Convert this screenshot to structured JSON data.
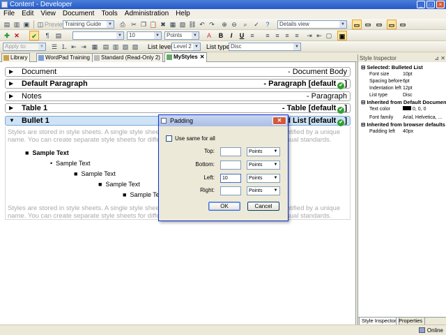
{
  "window": {
    "title": "Content - Developer"
  },
  "menu": [
    "File",
    "Edit",
    "View",
    "Document",
    "Tools",
    "Administration",
    "Help"
  ],
  "toolbar1": {
    "preview_label": "Preview",
    "template_combo": "Training Guide",
    "view_combo": "Details view"
  },
  "toolbar2": {
    "font_size_value": "10",
    "unit_value": "Points",
    "bold": "B",
    "italic": "I",
    "underline": "U"
  },
  "toolbar3": {
    "apply_to_label": "Apply to:",
    "list_level_label": "List level:",
    "list_level_value": "Level 2",
    "list_type_label": "List type:",
    "list_type_value": "Disc"
  },
  "tabs": [
    {
      "label": "Library"
    },
    {
      "label": "WordPad Training"
    },
    {
      "label": "Standard (Read-Only 2)"
    },
    {
      "label": "MyStyles"
    }
  ],
  "styles": [
    {
      "name": "Document",
      "right": "- Document Body",
      "checked": false
    },
    {
      "name": "Default Paragraph",
      "right": "- Paragraph [default",
      "checked": true
    },
    {
      "name": "Notes",
      "right": "- Paragraph",
      "checked": false
    },
    {
      "name": "Table 1",
      "right": "- Table [default",
      "checked": true
    },
    {
      "name": "Bullet 1",
      "right": "ed List [default",
      "checked": true
    }
  ],
  "preview": {
    "para_line1": "Styles are stored in style sheets. A single style sheet",
    "para_line1_end": "ntified by a unique",
    "para_line2": "name. You can create separate style sheets for differ",
    "para_line2_end": "sual standards.",
    "sample": "Sample Text",
    "sample_last": "Sample Te"
  },
  "dialog": {
    "title": "Padding",
    "same_for_all": "Use same for all",
    "top_label": "Top:",
    "bottom_label": "Bottom:",
    "left_label": "Left:",
    "right_label": "Right:",
    "top_value": "",
    "bottom_value": "",
    "left_value": "10",
    "right_value": "",
    "unit": "Points",
    "ok": "OK",
    "cancel": "Cancel"
  },
  "inspector": {
    "title": "Style Inspector",
    "selected_header": "Selected: Bulleted List",
    "selected_props": [
      {
        "k": "Font size",
        "v": "10pt"
      },
      {
        "k": "Spacing before",
        "v": "6pt"
      },
      {
        "k": "Indentation left",
        "v": "12pt"
      },
      {
        "k": "List type",
        "v": "Disc"
      }
    ],
    "inherited_doc_header": "Inherited from Default Documen",
    "inherited_doc_props": [
      {
        "k": "Text color",
        "v": "0, 0, 0"
      },
      {
        "k": "Font family",
        "v": "Arial, Helvetica, ..."
      }
    ],
    "inherited_browser_header": "Inherited from browser defaults",
    "inherited_browser_props": [
      {
        "k": "Padding left",
        "v": "40px"
      }
    ],
    "tab_inspector": "Style Inspector",
    "tab_properties": "Properties"
  },
  "status": {
    "online": "Online"
  },
  "colors": {
    "accent": "#2458c8",
    "check": "#2fa02f",
    "selected_row": "#cfe3f6"
  }
}
